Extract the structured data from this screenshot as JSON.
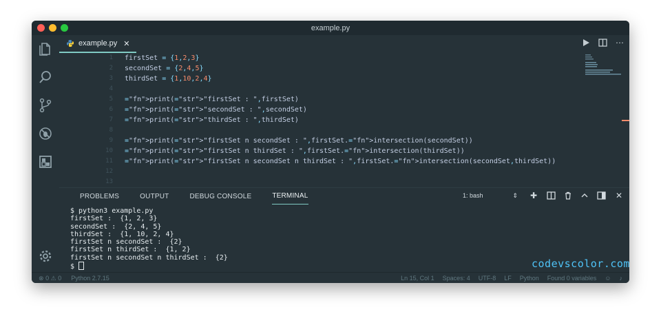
{
  "window": {
    "title": "example.py"
  },
  "colors": {
    "close": "#ff5f57",
    "minimize": "#febc2e",
    "zoom": "#28c840",
    "accent": "#80cbc4",
    "watermark": "#4fc3f7"
  },
  "activity_bar": [
    "files-icon",
    "search-icon",
    "source-control-icon",
    "debug-icon",
    "extensions-icon",
    "settings-icon"
  ],
  "tab": {
    "name": "example.py",
    "close": "✕"
  },
  "editor_actions": [
    "run-icon",
    "split-editor-icon",
    "more-icon"
  ],
  "code": {
    "lines": [
      {
        "n": "1",
        "text": "firstSet = {1,2,3}"
      },
      {
        "n": "2",
        "text": "secondSet = {2,4,5}"
      },
      {
        "n": "3",
        "text": "thirdSet = {1,10,2,4}"
      },
      {
        "n": "4",
        "text": ""
      },
      {
        "n": "5",
        "text": "print(\"firstSet : \",firstSet)"
      },
      {
        "n": "6",
        "text": "print(\"secondSet : \",secondSet)"
      },
      {
        "n": "7",
        "text": "print(\"thirdSet : \",thirdSet)"
      },
      {
        "n": "8",
        "text": ""
      },
      {
        "n": "9",
        "text": "print(\"firstSet n secondSet : \",firstSet.intersection(secondSet))"
      },
      {
        "n": "10",
        "text": "print(\"firstSet n thirdSet : \",firstSet.intersection(thirdSet))"
      },
      {
        "n": "11",
        "text": "print(\"firstSet n secondSet n thirdSet : \",firstSet.intersection(secondSet,thirdSet))"
      },
      {
        "n": "12",
        "text": ""
      },
      {
        "n": "13",
        "text": ""
      }
    ]
  },
  "panel": {
    "tabs": [
      "PROBLEMS",
      "OUTPUT",
      "DEBUG CONSOLE",
      "TERMINAL"
    ],
    "active_tab": "TERMINAL",
    "terminal_select": "1: bash",
    "controls": [
      "add-terminal-icon",
      "split-terminal-icon",
      "trash-icon",
      "chevron-up-icon",
      "maximize-panel-icon",
      "close-icon"
    ]
  },
  "terminal": {
    "lines": [
      "$ python3 example.py",
      "firstSet :  {1, 2, 3}",
      "secondSet :  {2, 4, 5}",
      "thirdSet :  {1, 10, 2, 4}",
      "firstSet n secondSet :  {2}",
      "firstSet n thirdSet :  {1, 2}",
      "firstSet n secondSet n thirdSet :  {2}"
    ],
    "prompt": "$ "
  },
  "watermark": "codevscolor.com",
  "status": {
    "errors": "0",
    "warnings": "0",
    "interpreter": "Python 2.7.15",
    "position": "Ln 15, Col 1",
    "spaces": "Spaces: 4",
    "encoding": "UTF-8",
    "eol": "LF",
    "language": "Python",
    "variables": "Found 0 variables"
  }
}
